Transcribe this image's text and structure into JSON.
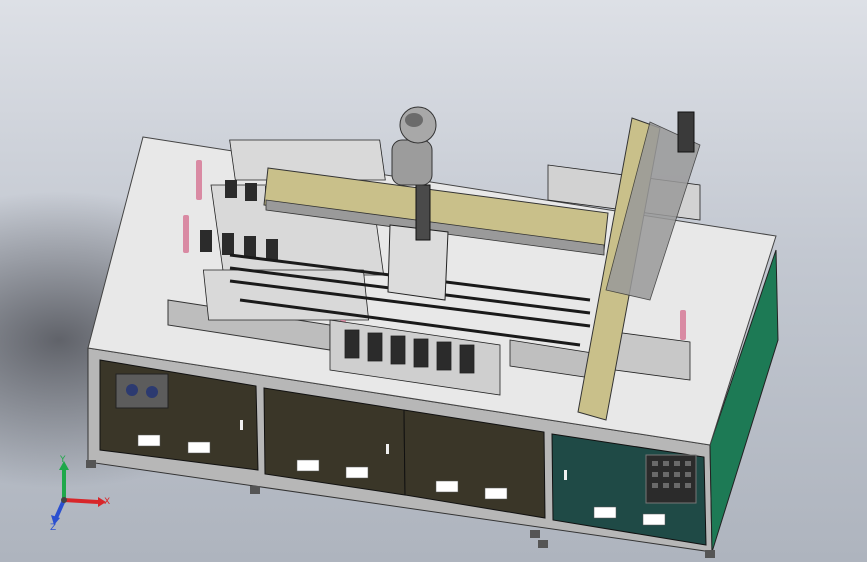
{
  "viewport": {
    "triad": {
      "x_label": "X",
      "y_label": "Y",
      "z_label": "Z",
      "x_color": "#d8262a",
      "y_color": "#1fa84a",
      "z_color": "#2a4fd0"
    }
  },
  "colors": {
    "background_top": "#dde0e6",
    "background_bottom": "#aeb4be",
    "tabletop": "#e8e8e8",
    "cabinet_panel": "#3a3628",
    "control_panel": "#1f4a46",
    "side_panel": "#1d7a55",
    "gantry_beam": "#c9c08a",
    "frame": "#8a8a8a"
  }
}
